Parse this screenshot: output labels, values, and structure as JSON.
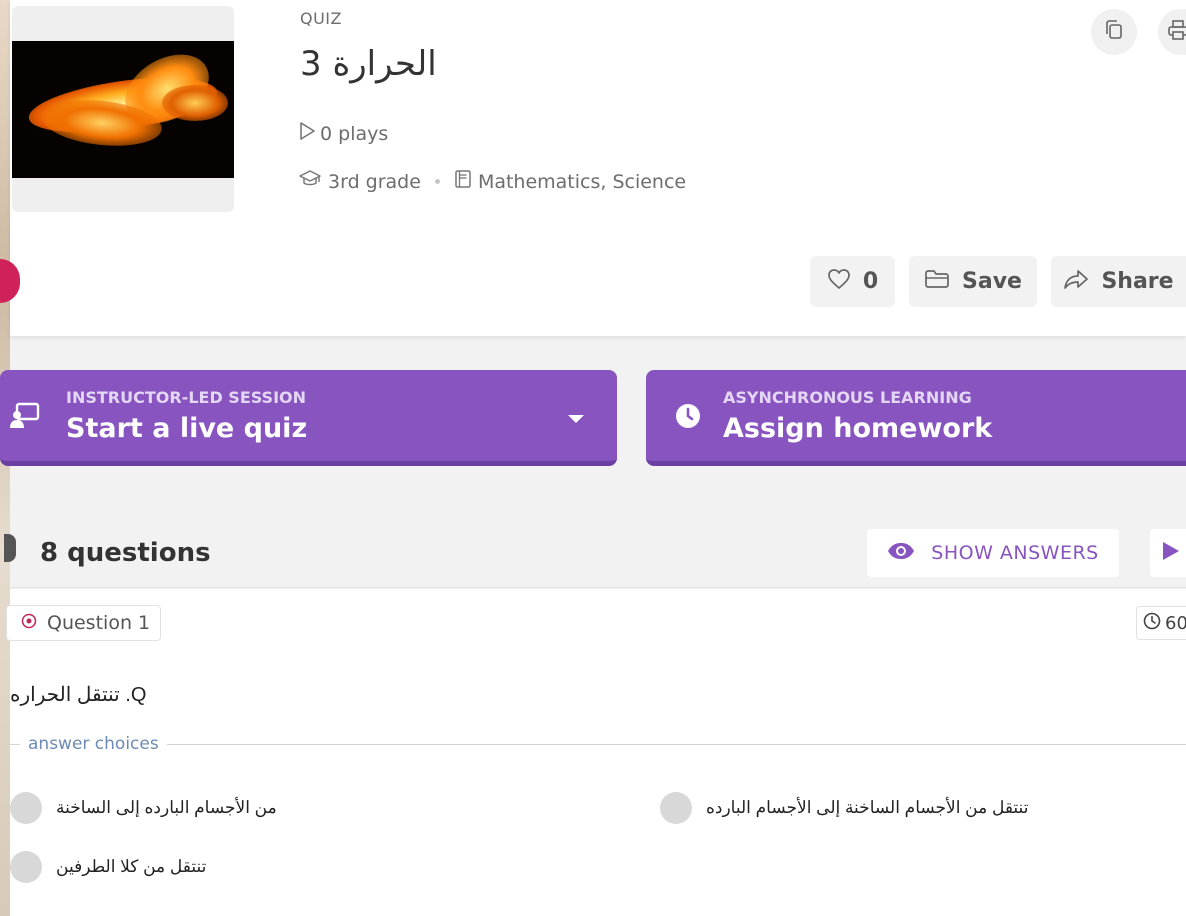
{
  "header": {
    "type_label": "QUIZ",
    "title": "الحرارة 3",
    "plays": "0 plays",
    "grade": "3rd grade",
    "subjects": "Mathematics, Science",
    "likes": "0",
    "save_label": "Save",
    "share_label": "Share"
  },
  "actions": {
    "live": {
      "small": "INSTRUCTOR-LED SESSION",
      "big": "Start a live quiz"
    },
    "homework": {
      "small": "ASYNCHRONOUS LEARNING",
      "big": "Assign homework"
    }
  },
  "questions": {
    "count_label": "8 questions",
    "show_answers_label": "SHOW ANSWERS"
  },
  "question": {
    "tag": "Question 1",
    "timer": "60",
    "text": "Q. تنتقل الحراره",
    "answer_choices_label": "answer choices",
    "choices": [
      "تنتقل من الأجسام الساخنة إلى الأجسام البارده",
      "من الأجسام البارده إلى الساخنة",
      "تنتقل من كلا الطرفين"
    ]
  },
  "colors": {
    "accent": "#8854c0",
    "accent_dark": "#6c3fa3",
    "avatar": "#d0225a",
    "link": "#6d8ab3"
  }
}
